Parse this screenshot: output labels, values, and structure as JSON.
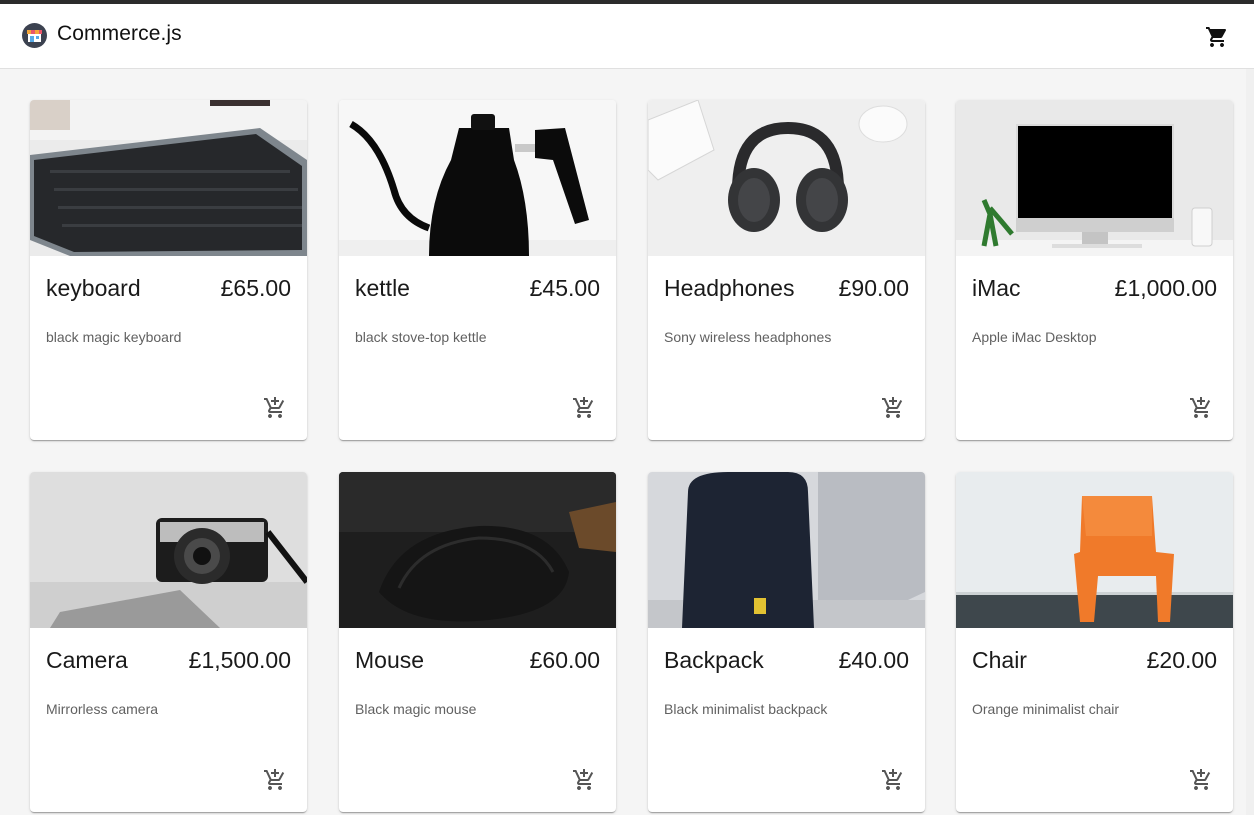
{
  "header": {
    "brand": "Commerce.js",
    "logo_icon": "store-logo-icon",
    "cart_icon": "shopping-cart-icon"
  },
  "products": [
    {
      "name": "keyboard",
      "price": "£65.00",
      "description": "black magic keyboard",
      "image": "keyboard-image",
      "add_icon": "add-to-cart-icon"
    },
    {
      "name": "kettle",
      "price": "£45.00",
      "description": "black stove-top kettle",
      "image": "kettle-image",
      "add_icon": "add-to-cart-icon"
    },
    {
      "name": "Headphones",
      "price": "£90.00",
      "description": "Sony wireless headphones",
      "image": "headphones-image",
      "add_icon": "add-to-cart-icon"
    },
    {
      "name": "iMac",
      "price": "£1,000.00",
      "description": "Apple iMac Desktop",
      "image": "imac-image",
      "add_icon": "add-to-cart-icon"
    },
    {
      "name": "Camera",
      "price": "£1,500.00",
      "description": "Mirrorless camera",
      "image": "camera-image",
      "add_icon": "add-to-cart-icon"
    },
    {
      "name": "Mouse",
      "price": "£60.00",
      "description": "Black magic mouse",
      "image": "mouse-image",
      "add_icon": "add-to-cart-icon"
    },
    {
      "name": "Backpack",
      "price": "£40.00",
      "description": "Black minimalist backpack",
      "image": "backpack-image",
      "add_icon": "add-to-cart-icon"
    },
    {
      "name": "Chair",
      "price": "£20.00",
      "description": "Orange minimalist chair",
      "image": "chair-image",
      "add_icon": "add-to-cart-icon"
    }
  ],
  "colors": {
    "appbar": "#ffffff",
    "page_background": "#f5f5f5",
    "text": "#1a1a1a",
    "secondary_text": "#616161",
    "chair_orange": "#f07a2a"
  }
}
